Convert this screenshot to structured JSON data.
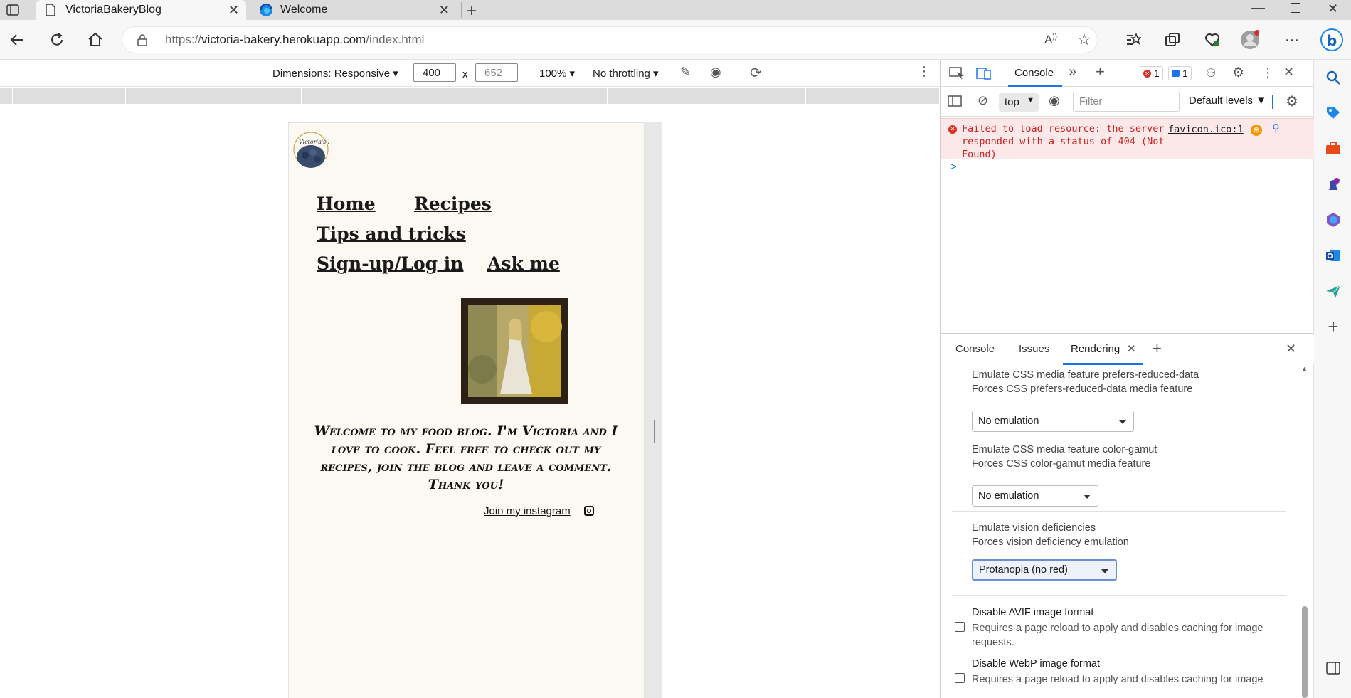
{
  "browser": {
    "tabs": [
      {
        "title": "VictoriaBakeryBlog",
        "icon": "page-icon",
        "active": true
      },
      {
        "title": "Welcome",
        "icon": "edge-icon",
        "active": false
      }
    ],
    "address": {
      "url_prefix": "https://",
      "url_host": "victoria-bakery.herokuapp.com",
      "url_path": "/index.html"
    }
  },
  "device_toolbar": {
    "dimensions_label": "Dimensions: Responsive",
    "width": "400",
    "height_placeholder": "652",
    "times": "x",
    "zoom": "100%",
    "throttling": "No throttling"
  },
  "site": {
    "logo_text": "Victoria's Bakery",
    "nav": {
      "home": "Home",
      "recipes": "Recipes",
      "tips": "Tips and tricks",
      "signup": "Sign-up/Log in",
      "ask": "Ask me"
    },
    "welcome": "Welcome to my food blog. I'm Victoria and I love to cook. Feel free to check out my recipes, join the blog and leave a comment. Thank you!",
    "instagram": "Join my instagram"
  },
  "devtools": {
    "top_tabs": {
      "console": "Console"
    },
    "error_count": "1",
    "message_count": "1",
    "context": "top",
    "filter_placeholder": "Filter",
    "levels": "Default levels",
    "error": {
      "message": "Failed to load resource: the server responded with a status of 404 (Not Found)",
      "source": "favicon.ico:1"
    },
    "prompt": ">",
    "drawer_tabs": {
      "console": "Console",
      "issues": "Issues",
      "rendering": "Rendering"
    },
    "rendering": {
      "reduced_data_title": "Emulate CSS media feature prefers-reduced-data",
      "reduced_data_desc": "Forces CSS prefers-reduced-data media feature",
      "reduced_data_value": "No emulation",
      "gamut_title": "Emulate CSS media feature color-gamut",
      "gamut_desc": "Forces CSS color-gamut media feature",
      "gamut_value": "No emulation",
      "vision_title": "Emulate vision deficiencies",
      "vision_desc": "Forces vision deficiency emulation",
      "vision_value": "Protanopia (no red)",
      "avif_title": "Disable AVIF image format",
      "avif_desc": "Requires a page reload to apply and disables caching for image requests.",
      "webp_title": "Disable WebP image format",
      "webp_desc": "Requires a page reload to apply and disables caching for image"
    }
  },
  "colors": {
    "error_bg": "#fce8e8",
    "error_text": "#c5221f",
    "accent": "#1a73e8",
    "page_bg": "#fbf9f1"
  }
}
